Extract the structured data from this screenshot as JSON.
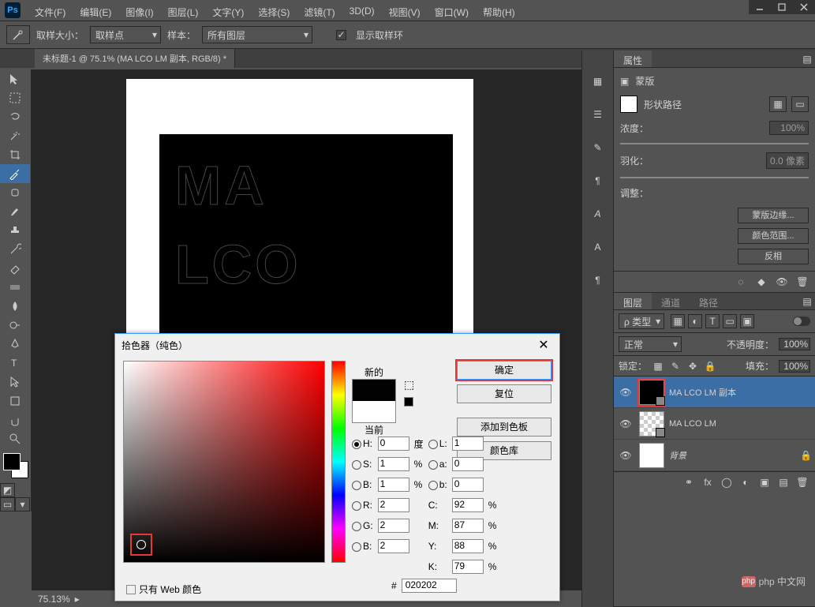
{
  "app": {
    "logo": "Ps"
  },
  "menubar": [
    "文件(F)",
    "编辑(E)",
    "图像(I)",
    "图层(L)",
    "文字(Y)",
    "选择(S)",
    "滤镜(T)",
    "3D(D)",
    "视图(V)",
    "窗口(W)",
    "帮助(H)"
  ],
  "optbar": {
    "sample_size_label": "取样大小：",
    "sample_size_value": "取样点",
    "sample_label": "样本：",
    "sample_value": "所有图层",
    "show_ring": "显示取样环"
  },
  "doc_tab": "未标题-1 @ 75.1% (MA LCO LM 副本, RGB/8) *",
  "canvas_text": {
    "line1": "MA",
    "line2": "LCO"
  },
  "status": {
    "zoom": "75.13%"
  },
  "properties": {
    "tab": "属性",
    "mask_label": "蒙版",
    "shape_path": "形状路径",
    "density_label": "浓度：",
    "density_value": "100%",
    "feather_label": "羽化：",
    "feather_value": "0.0 像素",
    "adjust_label": "调整：",
    "btn_edge": "蒙版边缘...",
    "btn_range": "颜色范围...",
    "btn_invert": "反相"
  },
  "layers": {
    "tabs": [
      "图层",
      "通道",
      "路径"
    ],
    "kind_label": "ρ 类型",
    "blend": "正常",
    "opacity_label": "不透明度：",
    "opacity_value": "100%",
    "lock_label": "锁定：",
    "fill_label": "填充：",
    "fill_value": "100%",
    "items": [
      {
        "name": "MA LCO LM 副本",
        "thumb": "black",
        "sel": true,
        "hl": true
      },
      {
        "name": "MA LCO LM",
        "thumb": "checker",
        "sel": false,
        "hl": false
      },
      {
        "name": "背景",
        "thumb": "white",
        "sel": false,
        "hl": false,
        "italic": true
      }
    ]
  },
  "picker": {
    "title": "拾色器（纯色）",
    "new": "新的",
    "current": "当前",
    "ok": "确定",
    "cancel": "复位",
    "add": "添加到色板",
    "lib": "颜色库",
    "H": "0",
    "S": "1",
    "Bv": "1",
    "R": "2",
    "G": "2",
    "B2": "2",
    "L": "1",
    "a": "0",
    "b": "0",
    "C": "92",
    "M": "87",
    "Y": "88",
    "K": "79",
    "unit_deg": "度",
    "unit_pct": "%",
    "hex": "020202",
    "web_only": "只有 Web 颜色"
  },
  "watermark": "php 中文网"
}
